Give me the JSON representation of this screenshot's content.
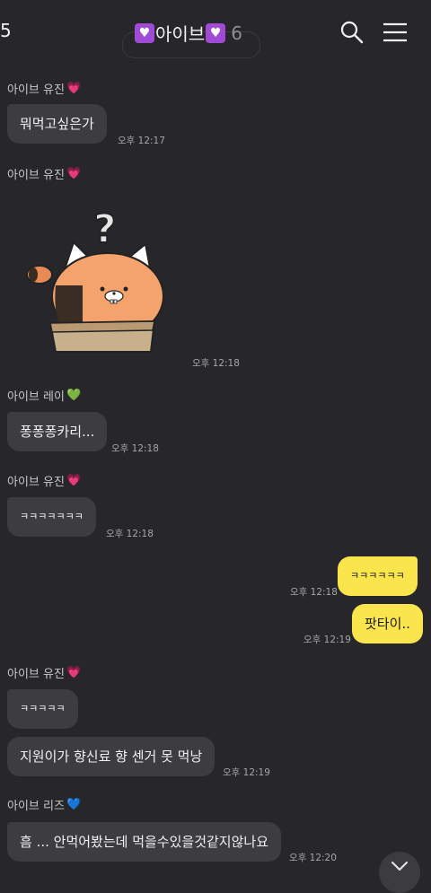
{
  "header": {
    "back_count": "5",
    "title": "아이브",
    "member_count": "6",
    "title_icon": "purple-heart-icon",
    "icons": [
      "search-icon",
      "menu-icon"
    ]
  },
  "colors": {
    "background": "#27272b",
    "incoming_bubble": "#3d3d41",
    "outgoing_bubble": "#fbe54d",
    "purple_heart": "#a04bd6",
    "pink_heart": "#f25aa8",
    "green_heart": "#45c93c",
    "blue_heart": "#4b8fe6"
  },
  "messages": [
    {
      "sender": "아이브 유진",
      "heart": "💗",
      "text": "뭐먹고싶은가",
      "time": "오후 12:17"
    },
    {
      "sender": "아이브 유진",
      "heart": "💗",
      "sticker": "cat-in-box-question-sticker",
      "time": "오후 12:18"
    },
    {
      "sender": "아이브 레이",
      "heart": "💚",
      "text": "퐁퐁퐁카리...",
      "time": "오후 12:18"
    },
    {
      "sender": "아이브 유진",
      "heart": "💗",
      "text": "ㅋㅋㅋㅋㅋㅋㅋ",
      "time": "오후 12:18"
    },
    {
      "outgoing": true,
      "text": "ㅋㅋㅋㅋㅋㅋ",
      "time": "오후 12:18"
    },
    {
      "outgoing": true,
      "text": "팟타이..",
      "time": "오후 12:19"
    },
    {
      "sender": "아이브 유진",
      "heart": "💗",
      "text": "ㅋㅋㅋㅋㅋ"
    },
    {
      "text": "지원이가 향신료 향 센거 못 먹낭",
      "time": "오후 12:19"
    },
    {
      "sender": "아이브 리즈",
      "heart": "💙",
      "text": "흠 ... 안먹어봤는데 먹을수있을것같지않나요",
      "time": "오후 12:20"
    }
  ]
}
